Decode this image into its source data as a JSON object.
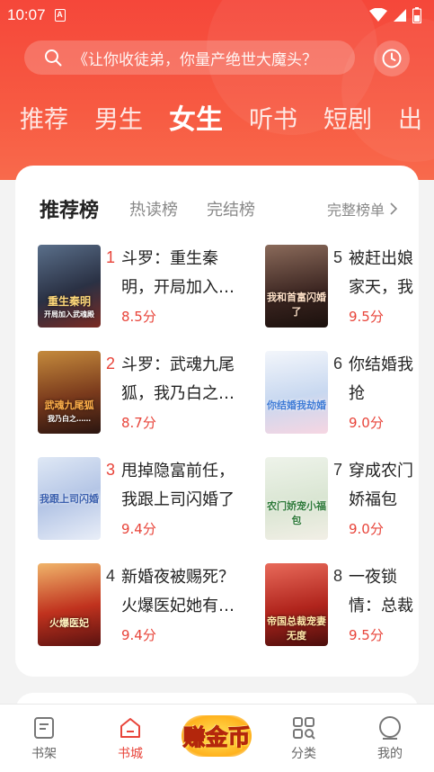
{
  "status_bar": {
    "time": "10:07",
    "notif_letter": "A"
  },
  "search": {
    "placeholder": "《让你收徒弟，你量产绝世大魔头？"
  },
  "tabs": [
    {
      "label": "推荐"
    },
    {
      "label": "男生"
    },
    {
      "label": "女生",
      "active": true
    },
    {
      "label": "听书"
    },
    {
      "label": "短剧"
    },
    {
      "label": "出"
    }
  ],
  "ranking": {
    "title": "推荐榜",
    "tabs": [
      "热读榜",
      "完结榜"
    ],
    "full_list": "完整榜单"
  },
  "books": [
    {
      "rank": "1",
      "title": "斗罗：重生秦明，开局加入…",
      "score": "8.5分",
      "cover_text": "重生秦明",
      "cover_sub": "开局加入武魂殿"
    },
    {
      "rank": "2",
      "title": "斗罗：武魂九尾狐，我乃白之…",
      "score": "8.7分",
      "cover_text": "武魂九尾狐",
      "cover_sub": "我乃白之……"
    },
    {
      "rank": "3",
      "title": "甩掉隐富前任，我跟上司闪婚了",
      "score": "9.4分",
      "cover_text": "我跟上司闪婚",
      "cover_sub": ""
    },
    {
      "rank": "4",
      "title": "新婚夜被赐死？火爆医妃她有…",
      "score": "9.4分",
      "cover_text": "火爆医妃",
      "cover_sub": ""
    },
    {
      "rank": "5",
      "title": "被赶出娘家天，我和首",
      "score": "9.5分",
      "cover_text": "我和首富闪婚了",
      "cover_sub": ""
    },
    {
      "rank": "6",
      "title": "你结婚我抢",
      "score": "9.0分",
      "cover_text": "你结婚我劫婚",
      "cover_sub": ""
    },
    {
      "rank": "7",
      "title": "穿成农门娇福包",
      "score": "9.0分",
      "cover_text": "农门娇宠小福包",
      "cover_sub": ""
    },
    {
      "rank": "8",
      "title": "一夜锁情：总裁宠妻无",
      "score": "9.5分",
      "cover_text": "帝国总裁宠妻无度",
      "cover_sub": ""
    }
  ],
  "bottom_nav": [
    {
      "label": "书架",
      "icon": "bookshelf-icon"
    },
    {
      "label": "书城",
      "icon": "bookstore-icon",
      "active": true
    },
    {
      "label": "赚金币",
      "icon": "coin-icon"
    },
    {
      "label": "分类",
      "icon": "category-icon"
    },
    {
      "label": "我的",
      "icon": "profile-icon"
    }
  ],
  "colors": {
    "header": "#f5473a",
    "accent": "#e8443a",
    "card": "#ffffff"
  }
}
